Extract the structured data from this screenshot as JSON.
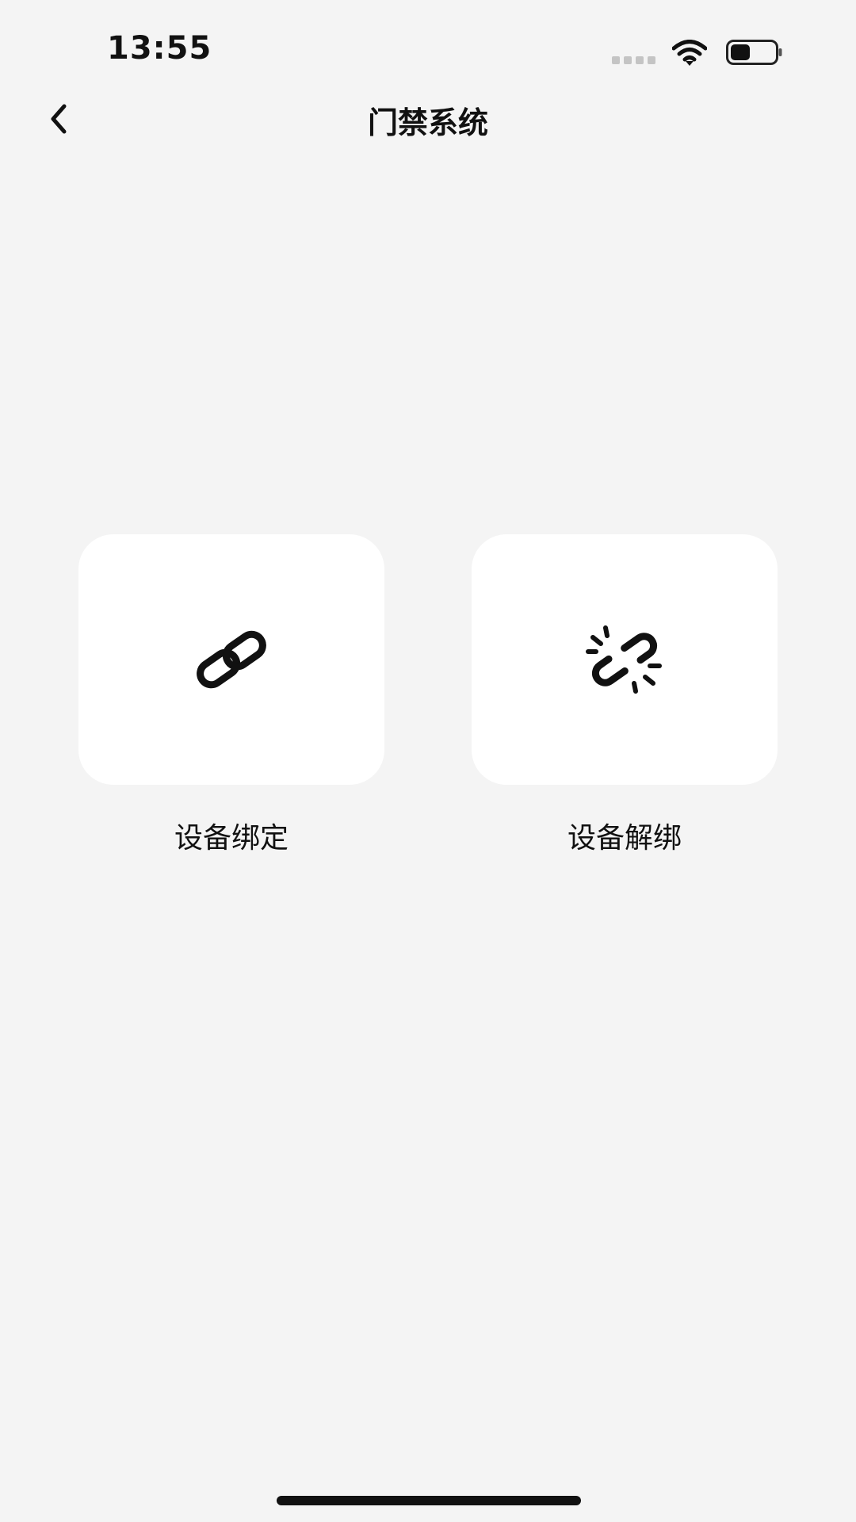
{
  "status_bar": {
    "time": "13:55",
    "icons": [
      "signal-icon",
      "wifi-icon",
      "battery-icon"
    ]
  },
  "nav": {
    "back_icon": "chevron-left-icon",
    "title": "门禁系统"
  },
  "actions": [
    {
      "label": "设备绑定",
      "icon": "link-icon"
    },
    {
      "label": "设备解绑",
      "icon": "unlink-icon"
    }
  ],
  "colors": {
    "background": "#f4f4f4",
    "card": "#ffffff",
    "text": "#111111"
  }
}
